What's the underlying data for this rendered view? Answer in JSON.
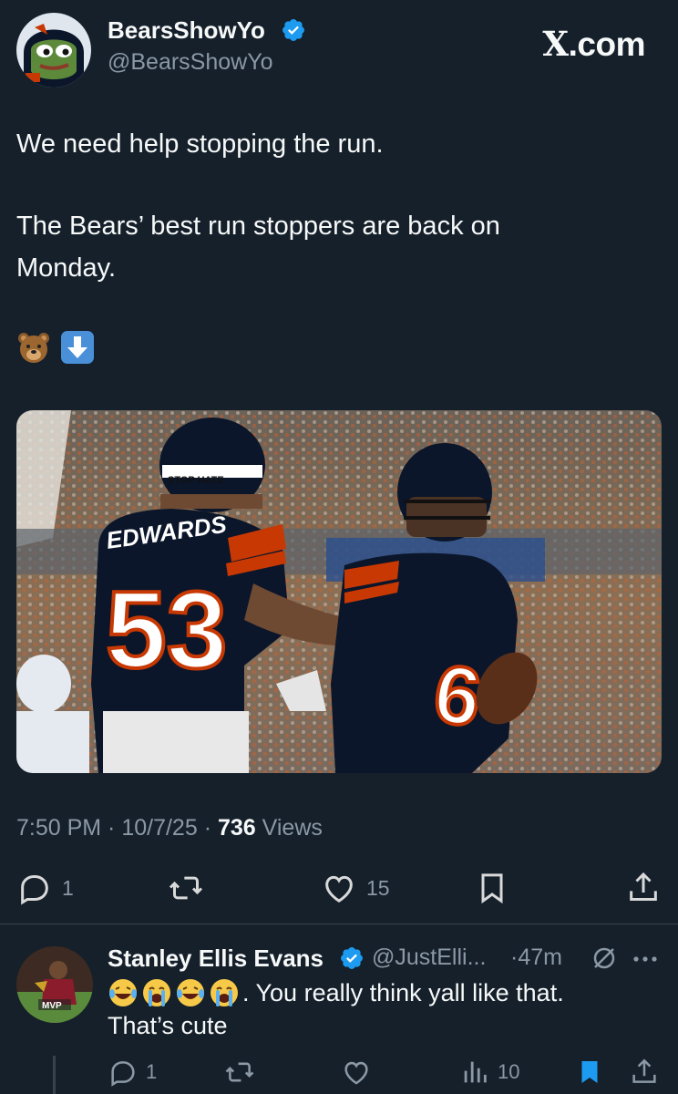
{
  "tweet": {
    "author": {
      "display_name": "BearsShowYo",
      "handle": "@BearsShowYo",
      "verified": true,
      "avatar_icon": "pepe-frog-bears-helmet-avatar"
    },
    "brand": {
      "x": "X",
      "rest": ".com"
    },
    "text_lines": [
      "We need help stopping the run.",
      "The Bears’ best run stoppers are back on",
      "Monday."
    ],
    "emojis": [
      "bear-face-icon",
      "down-arrow-icon"
    ],
    "image": {
      "jersey_name": "EDWARDS",
      "number_left": "53",
      "number_right": "6",
      "helmet_tag": "STOP HATE"
    },
    "meta": {
      "time": "7:50 PM",
      "date": "10/7/25",
      "views_count": "736",
      "views_label": "Views"
    },
    "actions": {
      "replies": "1",
      "retweets": "",
      "likes": "15"
    }
  },
  "reply": {
    "display_name": "Stanley Ellis Evans",
    "handle": "@JustElli...",
    "time": "47m",
    "verified": true,
    "avatar_text": "MVP",
    "emojis": [
      "laughing-crying-face-icon",
      "loudly-crying-face-icon",
      "laughing-crying-face-icon",
      "loudly-crying-face-icon"
    ],
    "text_after_emojis": ". You really think yall like that.",
    "line2": "That’s cute",
    "actions": {
      "replies": "1",
      "views": "10"
    }
  },
  "colors": {
    "background": "#15202b",
    "accent": "#1d9bf0",
    "muted": "#8b98a5",
    "divider": "#38444d"
  }
}
